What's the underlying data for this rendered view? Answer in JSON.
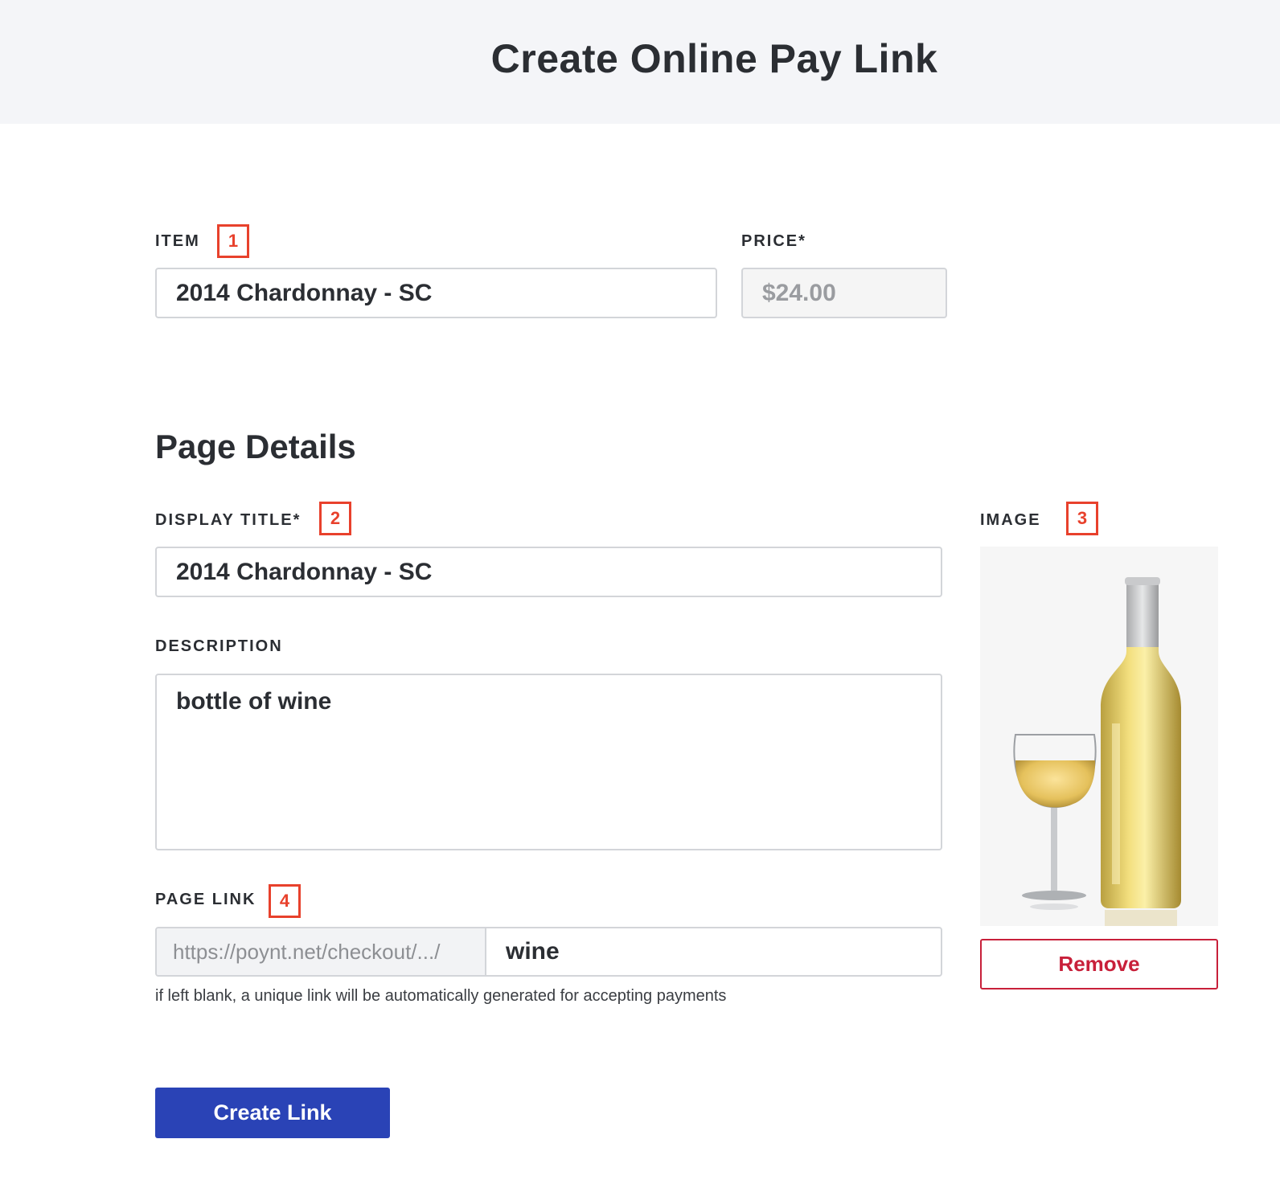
{
  "header": {
    "title": "Create Online Pay Link"
  },
  "item_field": {
    "label": "ITEM",
    "badge": "1",
    "value": "2014 Chardonnay - SC"
  },
  "price_field": {
    "label": "PRICE*",
    "value": "$24.00"
  },
  "page_details": {
    "heading": "Page Details",
    "display_title": {
      "label": "DISPLAY TITLE*",
      "badge": "2",
      "value": "2014 Chardonnay - SC"
    },
    "description": {
      "label": "DESCRIPTION",
      "value": "bottle of wine"
    },
    "page_link": {
      "label": "PAGE LINK",
      "badge": "4",
      "prefix": "https://poynt.net/checkout/.../",
      "value": "wine",
      "hint": "if left blank, a unique link will be automatically generated for accepting payments"
    },
    "image": {
      "label": "IMAGE",
      "badge": "3",
      "remove_label": "Remove"
    }
  },
  "actions": {
    "create_label": "Create Link"
  },
  "colors": {
    "badge": "#e8412c",
    "primary": "#2a43b6",
    "danger": "#c8203a",
    "header_bg": "#f4f5f8"
  }
}
